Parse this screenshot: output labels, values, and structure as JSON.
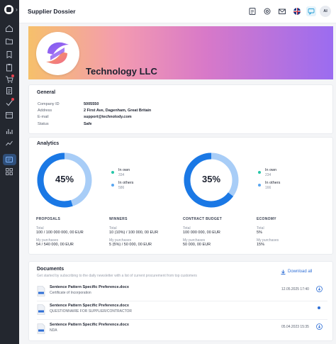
{
  "header": {
    "title": "Supplier Dossier",
    "avatar_initials": "AI"
  },
  "company": {
    "name": "Technology LLC"
  },
  "general": {
    "title": "General",
    "rows": [
      {
        "label": "Company ID",
        "value": "5005550"
      },
      {
        "label": "Address",
        "value": "2 First Ave, Dagenham, Great Britain"
      },
      {
        "label": "E-mail",
        "value": "support@technolody.com"
      },
      {
        "label": "Status",
        "value": "Safe"
      }
    ]
  },
  "analytics": {
    "title": "Analytics",
    "donuts": [
      {
        "percent": 45,
        "percent_label": "45%",
        "own_label": "In own",
        "own_count": "334",
        "others_label": "In others",
        "others_count": "586"
      },
      {
        "percent": 35,
        "percent_label": "35%",
        "own_label": "In own",
        "own_count": "234",
        "others_label": "In others",
        "others_count": "166"
      }
    ],
    "stats": [
      {
        "heading": "PROPOSALS",
        "total_label": "Total",
        "total_value": "100 / 100 000 000, 00 EUR",
        "mine_label": "My purchases",
        "mine_value": "54 / 540 000, 00 EUR"
      },
      {
        "heading": "WINNERS",
        "total_label": "Total",
        "total_value": "10  (10%) / 100 000, 00 EUR",
        "mine_label": "My purchases",
        "mine_value": "5 (5%) / 50 000, 00 EUR"
      },
      {
        "heading": "CONTRACT BUDGET",
        "total_label": "Total",
        "total_value": "100 000 000, 00 EUR",
        "mine_label": "My purchases",
        "mine_value": "50 000, 00 EUR"
      },
      {
        "heading": "ECONOMY",
        "total_label": "Total",
        "total_value": "5%",
        "mine_label": "My purchases",
        "mine_value": "15%"
      }
    ]
  },
  "documents": {
    "title": "Documents",
    "subtitle": "Get started by subscribing to the daily newsletter with a list of current procurement from top customers",
    "download_all": "Download all",
    "items": [
      {
        "name": "Sentence Pattern Specific Preference.docx",
        "desc": "Certificate of Incorporation",
        "date": "12.05.2025",
        "time": "17:40"
      },
      {
        "name": "Sentence Pattern Specific Preference.docx",
        "desc": "QUESTIONNAIRE FOR SUPPLIER/CONTRACTOR",
        "date": "",
        "time": ""
      },
      {
        "name": "Sentence Pattern Specific Preference.docx",
        "desc": "NDA",
        "date": "05.04.2023",
        "time": "15:35"
      }
    ]
  },
  "colors": {
    "accent": "#2f6fd6",
    "donut_main": "#1a78e5",
    "donut_light": "#a8cdf7",
    "own_dot": "#26c6a8",
    "others_dot": "#5aa6f0"
  }
}
